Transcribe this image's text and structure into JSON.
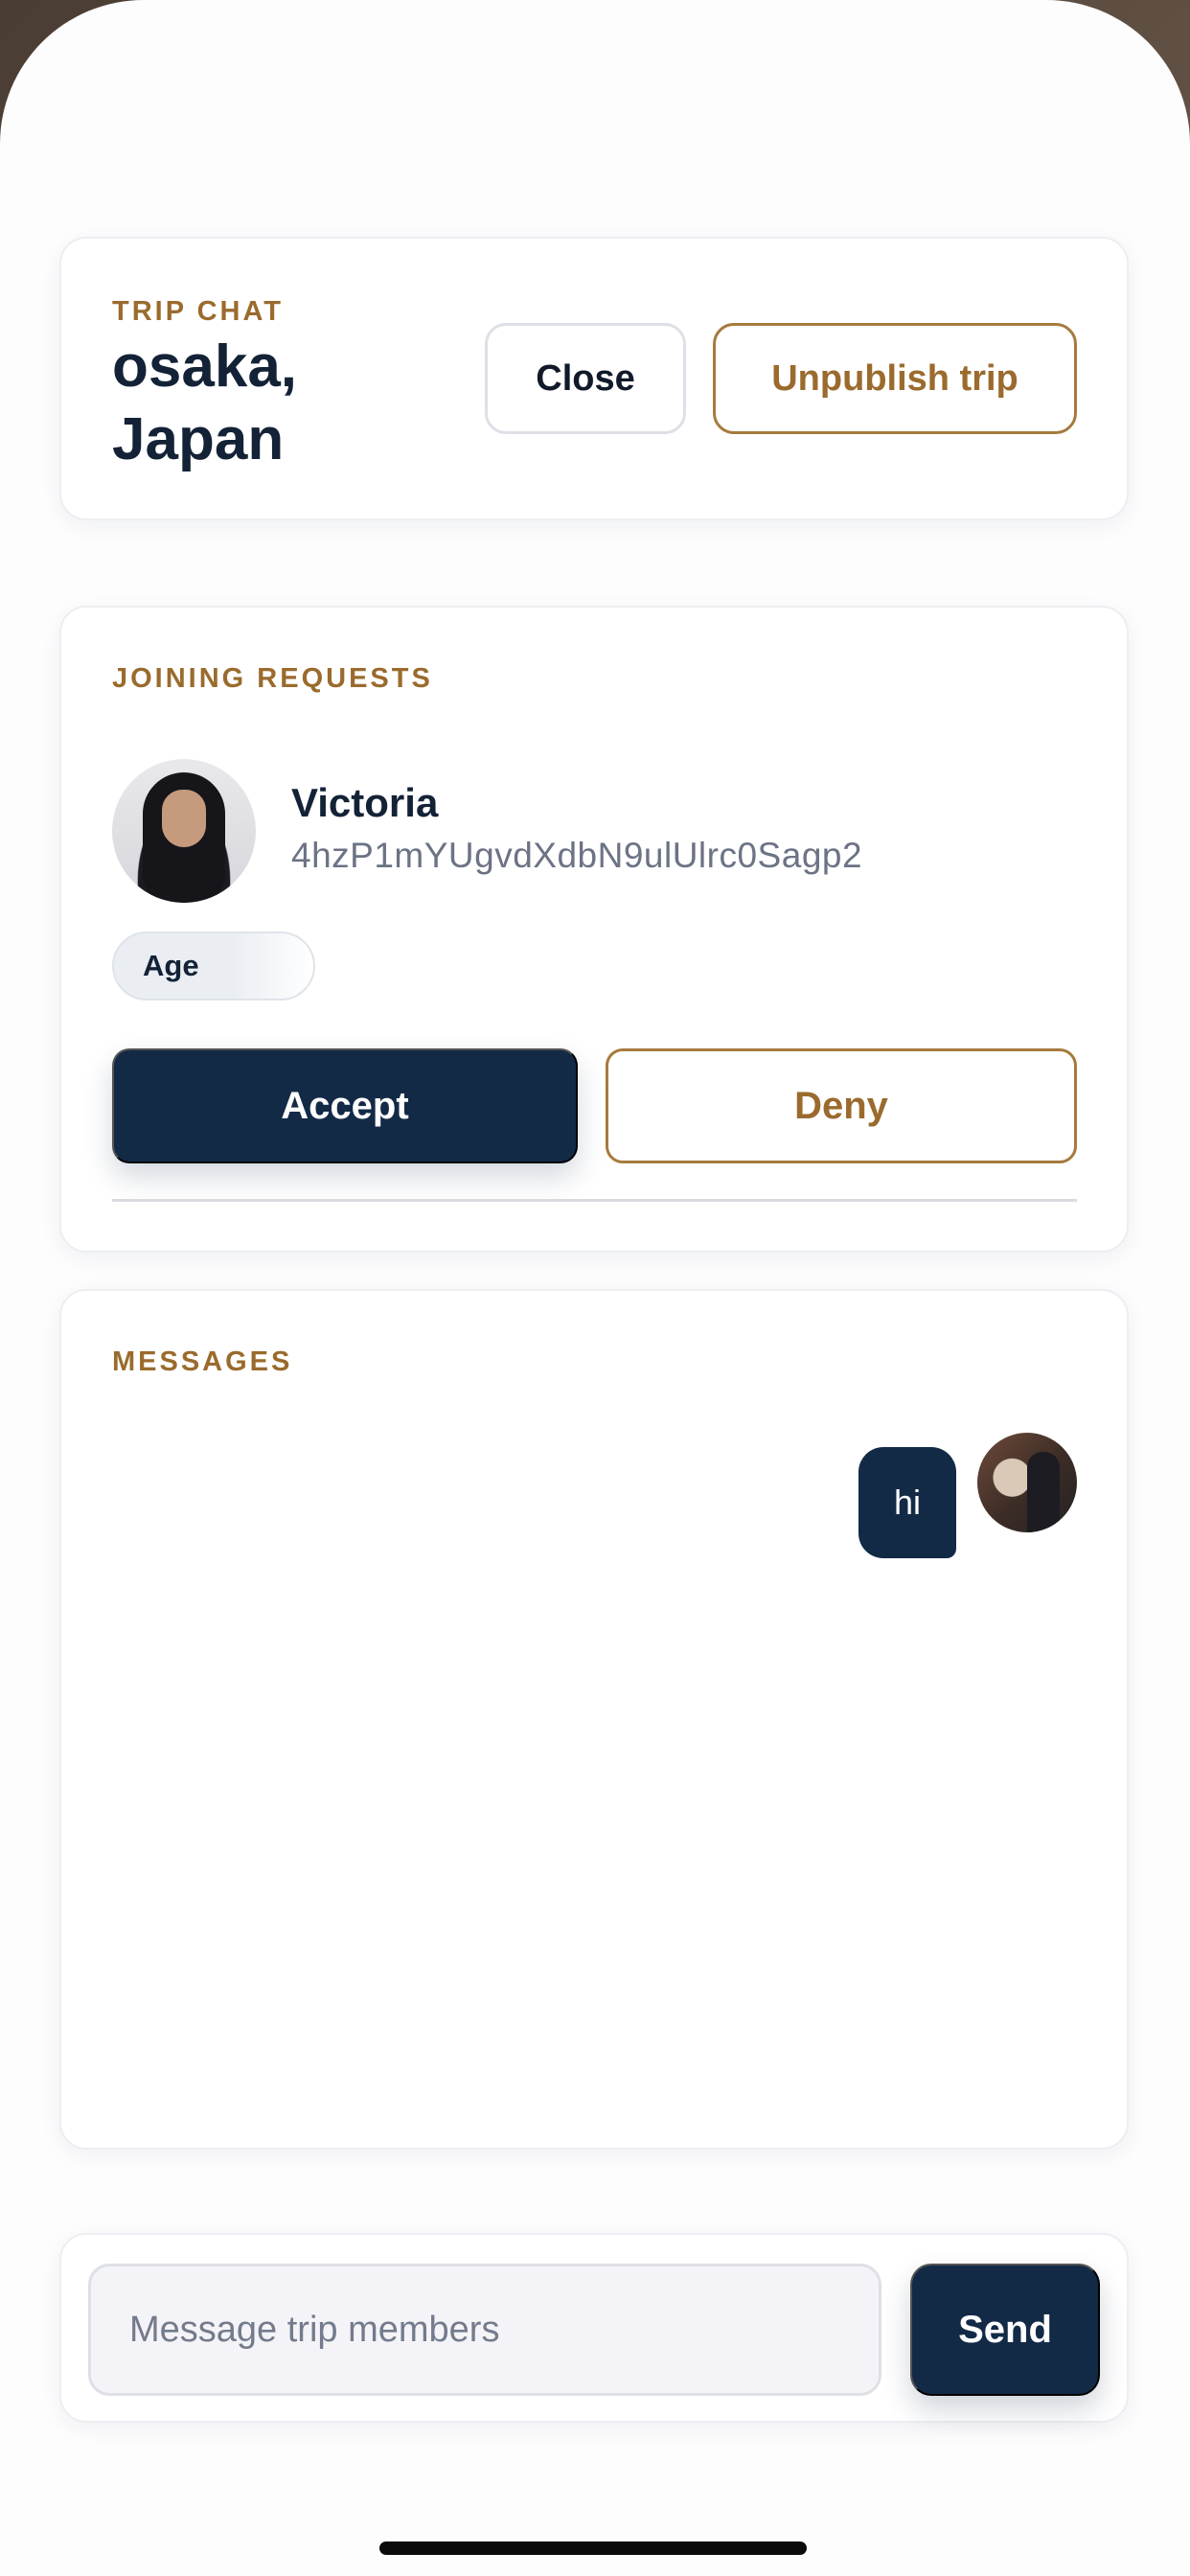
{
  "header": {
    "eyebrow": "TRIP CHAT",
    "title": "osaka, Japan",
    "close_label": "Close",
    "unpublish_label": "Unpublish trip"
  },
  "requests": {
    "eyebrow": "JOINING REQUESTS",
    "items": [
      {
        "name": "Victoria",
        "user_id": "4hzP1mYUgvdXdbN9ulUlrc0Sagp2",
        "age_chip": "Age",
        "accept_label": "Accept",
        "deny_label": "Deny"
      }
    ]
  },
  "messages": {
    "eyebrow": "MESSAGES",
    "items": [
      {
        "text": "hi",
        "from": "self"
      }
    ]
  },
  "composer": {
    "placeholder": "Message trip members",
    "send_label": "Send"
  },
  "colors": {
    "accent_gold": "#9a6b2d",
    "primary_navy": "#132a47"
  }
}
